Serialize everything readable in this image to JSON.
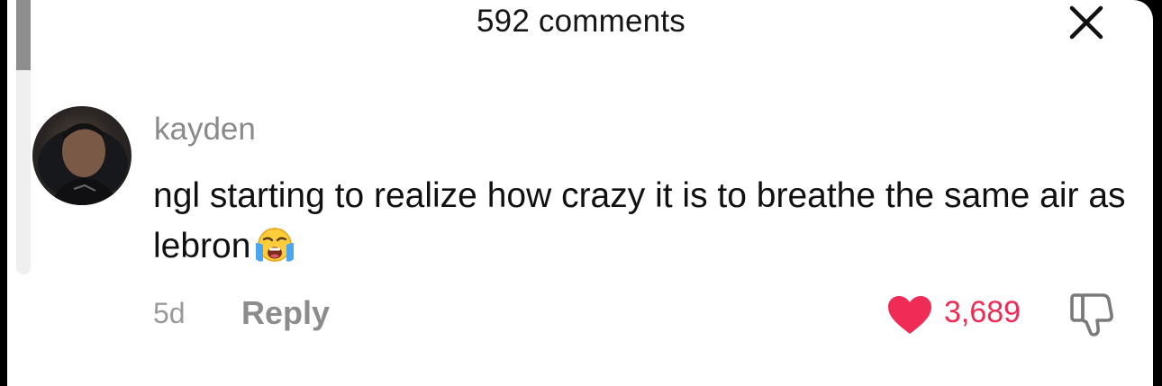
{
  "header": {
    "title": "592 comments"
  },
  "comment": {
    "username": "kayden",
    "text": "ngl starting to realize how crazy it is to breathe the same air as lebron",
    "emoji": "loudly-crying-face",
    "age": "5d",
    "reply_label": "Reply",
    "like_count": "3,689",
    "liked": true
  },
  "colors": {
    "like": "#f02c56",
    "muted": "#8c8c8c",
    "text": "#111111"
  }
}
